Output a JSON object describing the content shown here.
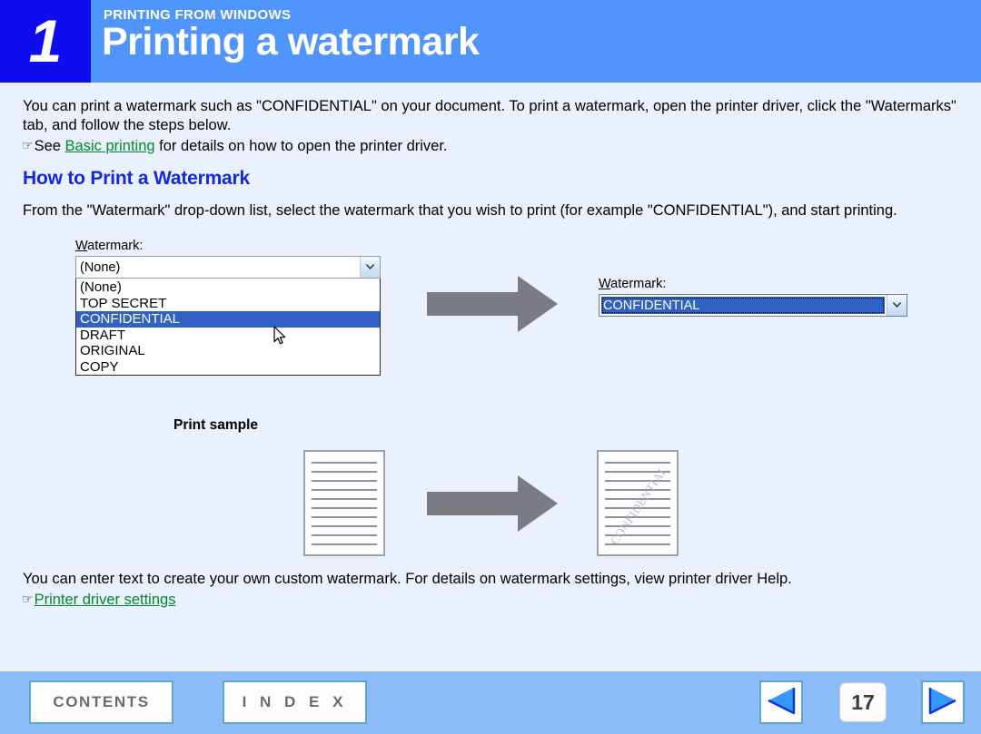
{
  "header": {
    "chapter_number": "1",
    "eyebrow": "PRINTING FROM WINDOWS",
    "title": "Printing a watermark",
    "badge_color": "#0d0ded",
    "bar_color": "#4f95fb"
  },
  "content": {
    "intro_paragraph": "You can print a watermark such as \"CONFIDENTIAL\" on your document. To print a watermark, open the printer driver, click the \"Watermarks\" tab, and follow the steps below.",
    "see_prefix": "See ",
    "see_link": "Basic printing",
    "see_suffix": " for details on how to open the printer driver.",
    "section_heading": "How to Print a Watermark",
    "howto_paragraph": "From the \"Watermark\" drop-down list, select the watermark that you wish to print (for example \"CONFIDENTIAL\"), and start printing.",
    "enter_paragraph": "You can enter text to create your own custom watermark. For details on watermark settings, view printer driver Help.",
    "driver_link": "Printer driver settings",
    "link_color": "#008a2e",
    "heading_color": "#1428e0"
  },
  "combo_before": {
    "label_accel": "W",
    "label_rest": "atermark:",
    "value": "(None)",
    "options": [
      "(None)",
      "TOP SECRET",
      "CONFIDENTIAL",
      "DRAFT",
      "ORIGINAL",
      "COPY"
    ],
    "highlighted_option": "CONFIDENTIAL",
    "highlight_color": "#2f62c4"
  },
  "combo_after": {
    "label_accel": "W",
    "label_rest": "atermark:",
    "value": "CONFIDENTIAL"
  },
  "print_sample": {
    "label": "Print sample",
    "plain_lines": 10,
    "marked_lines": 10,
    "watermark_text": "CONFIDENTIAL",
    "watermark_color": "#b9b9c9"
  },
  "footer": {
    "contents_label": "CONTENTS",
    "index_label": "I N D E X",
    "page_number": "17",
    "prev_icon": "triangle-left-icon",
    "next_icon": "triangle-right-icon",
    "bar_color": "#8cbcf8"
  }
}
